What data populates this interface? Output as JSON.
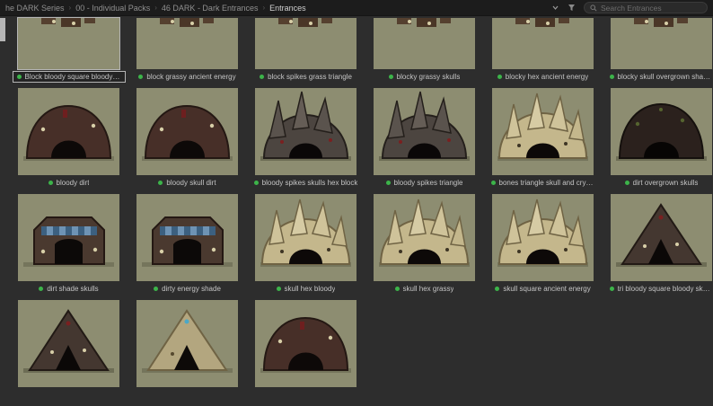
{
  "topbar": {
    "breadcrumbs": [
      {
        "label": "he DARK Series"
      },
      {
        "label": "00 - Individual Packs"
      },
      {
        "label": "46 DARK - Dark Entrances"
      },
      {
        "label": "Entrances"
      }
    ],
    "separator": "›",
    "search": {
      "placeholder": "Search Entrances"
    },
    "icons": {
      "dropdown": "chevron-down",
      "filter": "funnel",
      "search": "magnifier"
    }
  },
  "colors": {
    "accent_green": "#3cb44a",
    "thumbnail_background": "#8d8d71",
    "page_background": "#2d2d2d",
    "selection_border": "#b5b5b5"
  },
  "grid": {
    "items": [
      {
        "row": 1,
        "label": "Block bloody square bloody skulls",
        "shape": "cut",
        "selected": true
      },
      {
        "row": 1,
        "label": "block grassy ancient energy",
        "shape": "cut",
        "selected": false
      },
      {
        "row": 1,
        "label": "block spikes grass triangle",
        "shape": "cut",
        "selected": false
      },
      {
        "row": 1,
        "label": "blocky grassy skulls",
        "shape": "cut",
        "selected": false
      },
      {
        "row": 1,
        "label": "blocky hex ancient energy",
        "shape": "cut",
        "selected": false
      },
      {
        "row": 1,
        "label": "blocky skull overgrown shader",
        "shape": "cut",
        "selected": false
      },
      {
        "row": 2,
        "label": "bloody dirt",
        "shape": "arch-brown",
        "selected": false
      },
      {
        "row": 2,
        "label": "bloody skull dirt",
        "shape": "arch-brown",
        "selected": false
      },
      {
        "row": 2,
        "label": "bloody spikes skulls hex block",
        "shape": "spiky-dark",
        "selected": false
      },
      {
        "row": 2,
        "label": "bloody spikes triangle",
        "shape": "spiky-dark",
        "selected": false
      },
      {
        "row": 2,
        "label": "bones triangle skull and crystals",
        "shape": "spiky-bone",
        "selected": false
      },
      {
        "row": 2,
        "label": "dirt overgrown skulls",
        "shape": "arch-dark",
        "selected": false
      },
      {
        "row": 3,
        "label": "dirt shade skulls",
        "shape": "awning",
        "selected": false
      },
      {
        "row": 3,
        "label": "dirty energy shade",
        "shape": "awning",
        "selected": false
      },
      {
        "row": 3,
        "label": "skull hex bloody",
        "shape": "spiky-bone",
        "selected": false
      },
      {
        "row": 3,
        "label": "skull hex grassy",
        "shape": "spiky-bone",
        "selected": false
      },
      {
        "row": 3,
        "label": "skull square ancient energy",
        "shape": "spiky-bone",
        "selected": false
      },
      {
        "row": 3,
        "label": "tri bloody square bloody skulls",
        "shape": "tri-dark",
        "selected": false
      },
      {
        "row": 4,
        "label": null,
        "shape": "tri-dark",
        "selected": false
      },
      {
        "row": 4,
        "label": null,
        "shape": "tri-bone",
        "selected": false
      },
      {
        "row": 4,
        "label": null,
        "shape": "arch-brown",
        "selected": false
      }
    ]
  }
}
